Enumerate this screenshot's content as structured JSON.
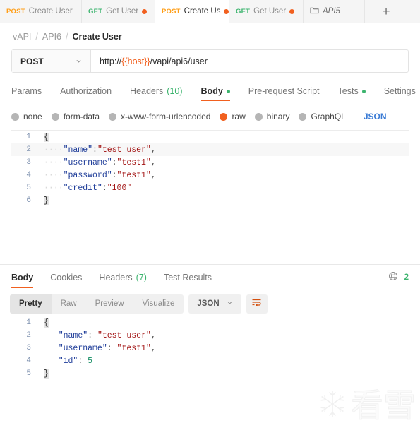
{
  "tabs": {
    "items": [
      {
        "method": "POST",
        "method_class": "post",
        "label": "Create User",
        "unsaved": false,
        "active": false
      },
      {
        "method": "GET",
        "method_class": "get",
        "label": "Get User",
        "unsaved": true,
        "active": false
      },
      {
        "method": "POST",
        "method_class": "post",
        "label": "Create Us",
        "unsaved": true,
        "active": true
      },
      {
        "method": "GET",
        "method_class": "get",
        "label": "Get User",
        "unsaved": true,
        "active": false
      }
    ],
    "folder_tab": {
      "icon": "folder-icon",
      "label": "API5"
    },
    "new_tab": {
      "icon": "plus-icon",
      "label": "+"
    }
  },
  "breadcrumb": {
    "items": [
      "vAPI",
      "API6",
      "Create User"
    ],
    "separator": "/"
  },
  "request": {
    "method": "POST",
    "method_chevron_icon": "chevron-down-icon",
    "url_prefix": "http://",
    "url_variable": "{{host}}",
    "url_suffix": "/vapi/api6/user",
    "url_full": "http://{{host}}/vapi/api6/user"
  },
  "request_tabs": [
    {
      "label": "Params",
      "count": "",
      "dot": false,
      "active": false
    },
    {
      "label": "Authorization",
      "count": "",
      "dot": false,
      "active": false
    },
    {
      "label": "Headers",
      "count": "(10)",
      "dot": false,
      "active": false
    },
    {
      "label": "Body",
      "count": "",
      "dot": true,
      "active": true
    },
    {
      "label": "Pre-request Script",
      "count": "",
      "dot": false,
      "active": false
    },
    {
      "label": "Tests",
      "count": "",
      "dot": true,
      "active": false
    },
    {
      "label": "Settings",
      "count": "",
      "dot": false,
      "active": false
    }
  ],
  "body_types": {
    "options": [
      {
        "label": "none",
        "selected": false
      },
      {
        "label": "form-data",
        "selected": false
      },
      {
        "label": "x-www-form-urlencoded",
        "selected": false
      },
      {
        "label": "raw",
        "selected": true
      },
      {
        "label": "binary",
        "selected": false
      },
      {
        "label": "GraphQL",
        "selected": false
      }
    ],
    "format_label": "JSON"
  },
  "request_body": {
    "lines": [
      {
        "num": "1",
        "tokens": [
          {
            "t": "brace",
            "v": "{"
          }
        ]
      },
      {
        "num": "2",
        "tokens": [
          {
            "t": "ws",
            "v": "····"
          },
          {
            "t": "k",
            "v": "\"name\""
          },
          {
            "t": "p",
            "v": ":"
          },
          {
            "t": "s",
            "v": "\"test user\""
          },
          {
            "t": "p",
            "v": ","
          }
        ]
      },
      {
        "num": "3",
        "tokens": [
          {
            "t": "ws",
            "v": "····"
          },
          {
            "t": "k",
            "v": "\"username\""
          },
          {
            "t": "p",
            "v": ":"
          },
          {
            "t": "s",
            "v": "\"test1\""
          },
          {
            "t": "p",
            "v": ","
          }
        ]
      },
      {
        "num": "4",
        "tokens": [
          {
            "t": "ws",
            "v": "····"
          },
          {
            "t": "k",
            "v": "\"password\""
          },
          {
            "t": "p",
            "v": ":"
          },
          {
            "t": "s",
            "v": "\"test1\""
          },
          {
            "t": "p",
            "v": ","
          }
        ]
      },
      {
        "num": "5",
        "tokens": [
          {
            "t": "ws",
            "v": "····"
          },
          {
            "t": "k",
            "v": "\"credit\""
          },
          {
            "t": "p",
            "v": ":"
          },
          {
            "t": "s",
            "v": "\"100\""
          }
        ]
      },
      {
        "num": "6",
        "tokens": [
          {
            "t": "brace",
            "v": "}"
          }
        ]
      }
    ]
  },
  "response_tabs": [
    {
      "label": "Body",
      "count": "",
      "active": true
    },
    {
      "label": "Cookies",
      "count": "",
      "active": false
    },
    {
      "label": "Headers",
      "count": "(7)",
      "active": false
    },
    {
      "label": "Test Results",
      "count": "",
      "active": false
    }
  ],
  "response_meta": {
    "globe_icon": "globe-icon",
    "status_code": "2"
  },
  "response_toolbar": {
    "views": [
      {
        "label": "Pretty",
        "active": true
      },
      {
        "label": "Raw",
        "active": false
      },
      {
        "label": "Preview",
        "active": false
      },
      {
        "label": "Visualize",
        "active": false
      }
    ],
    "format_label": "JSON",
    "format_chevron_icon": "chevron-down-icon",
    "wrap_icon": "word-wrap-icon"
  },
  "response_body": {
    "lines": [
      {
        "num": "1",
        "tokens": [
          {
            "t": "brace",
            "v": "{"
          }
        ]
      },
      {
        "num": "2",
        "tokens": [
          {
            "t": "ws",
            "v": "   "
          },
          {
            "t": "k",
            "v": "\"name\""
          },
          {
            "t": "p",
            "v": ": "
          },
          {
            "t": "s",
            "v": "\"test user\""
          },
          {
            "t": "p",
            "v": ","
          }
        ]
      },
      {
        "num": "3",
        "tokens": [
          {
            "t": "ws",
            "v": "   "
          },
          {
            "t": "k",
            "v": "\"username\""
          },
          {
            "t": "p",
            "v": ": "
          },
          {
            "t": "s",
            "v": "\"test1\""
          },
          {
            "t": "p",
            "v": ","
          }
        ]
      },
      {
        "num": "4",
        "tokens": [
          {
            "t": "ws",
            "v": "   "
          },
          {
            "t": "k",
            "v": "\"id\""
          },
          {
            "t": "p",
            "v": ": "
          },
          {
            "t": "n",
            "v": "5"
          }
        ]
      },
      {
        "num": "5",
        "tokens": [
          {
            "t": "brace",
            "v": "}"
          }
        ]
      }
    ]
  },
  "watermark": {
    "icon": "snowflake-icon",
    "text": "看雪"
  },
  "colors": {
    "accent_orange": "#f1601f",
    "method_post": "#ff9f1a",
    "method_get": "#3cb46e",
    "status_green": "#3cb46e",
    "json_link_blue": "#3a7bd5"
  }
}
